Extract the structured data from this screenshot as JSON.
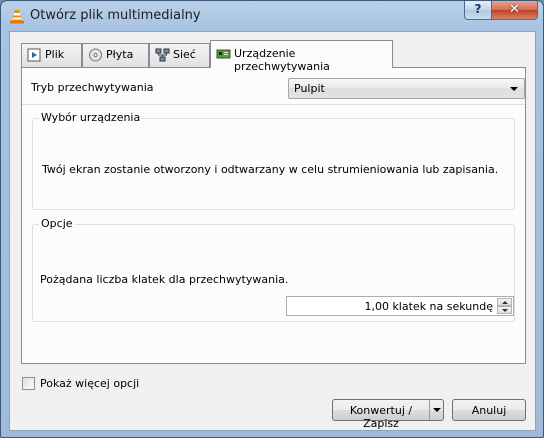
{
  "window": {
    "title": "Otwórz plik multimedialny",
    "help_glyph": "?",
    "close_glyph": "✕",
    "accent_color": "#f08a00"
  },
  "tabs": [
    {
      "label": "Plik",
      "icon": "file-media-icon",
      "active": false
    },
    {
      "label": "Płyta",
      "icon": "disc-icon",
      "active": false
    },
    {
      "label": "Sieć",
      "icon": "network-icon",
      "active": false
    },
    {
      "label": "Urządzenie przechwytywania",
      "icon": "capture-card-icon",
      "active": true
    }
  ],
  "capture": {
    "mode_label": "Tryb przechwytywania",
    "mode_value": "Pulpit",
    "device_group_title": "Wybór urządzenia",
    "device_info": "Twój ekran zostanie otworzony i odtwarzany w celu strumieniowania lub zapisania.",
    "options_group_title": "Opcje",
    "framerate_label": "Pożądana liczba klatek dla przechwytywania.",
    "framerate_value": "1,00 klatek na sekundę"
  },
  "footer": {
    "more_options_label": "Pokaż więcej opcji",
    "more_options_checked": false,
    "convert_label": "Konwertuj / Zapisz",
    "cancel_label": "Anuluj"
  }
}
